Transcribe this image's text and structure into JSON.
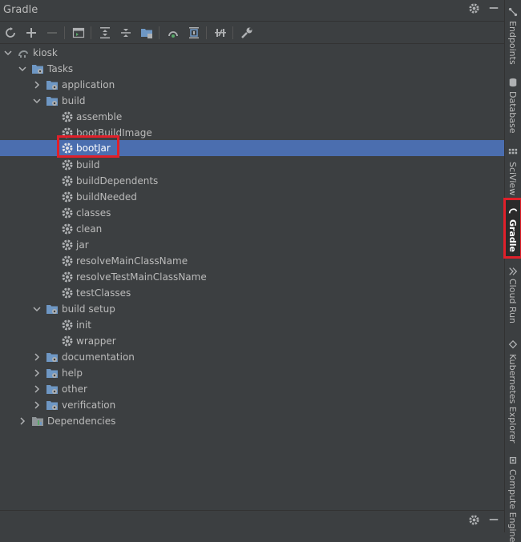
{
  "panel": {
    "title": "Gradle"
  },
  "toolbar": {
    "buttons": [
      "reload-all-icon",
      "add-icon",
      "remove-icon",
      "run-task-icon",
      "expand-all-icon",
      "collapse-all-icon",
      "group-icon",
      "offline-mode-icon",
      "analyze-deps-icon",
      "toggle-offline-icon",
      "settings-wrench-icon"
    ]
  },
  "tree": {
    "root": "kiosk",
    "tasks": "Tasks",
    "groups": {
      "application": "application",
      "build": "build",
      "build_setup": "build setup",
      "documentation": "documentation",
      "help": "help",
      "other": "other",
      "verification": "verification"
    },
    "build_tasks": [
      "assemble",
      "bootBuildImage",
      "bootJar",
      "build",
      "buildDependents",
      "buildNeeded",
      "classes",
      "clean",
      "jar",
      "resolveMainClassName",
      "resolveTestMainClassName",
      "testClasses"
    ],
    "build_setup_tasks": [
      "init",
      "wrapper"
    ],
    "dependencies": "Dependencies",
    "selected": "bootJar"
  },
  "side_tabs": [
    "Endpoints",
    "Database",
    "SciView",
    "Gradle",
    "Cloud Run",
    "Kubernetes Explorer",
    "Compute Engine"
  ],
  "colors": {
    "background": "#3c3f41",
    "selection": "#4b6eaf",
    "highlight_box": "#e0202a",
    "folder_blue": "#6e97c4"
  }
}
